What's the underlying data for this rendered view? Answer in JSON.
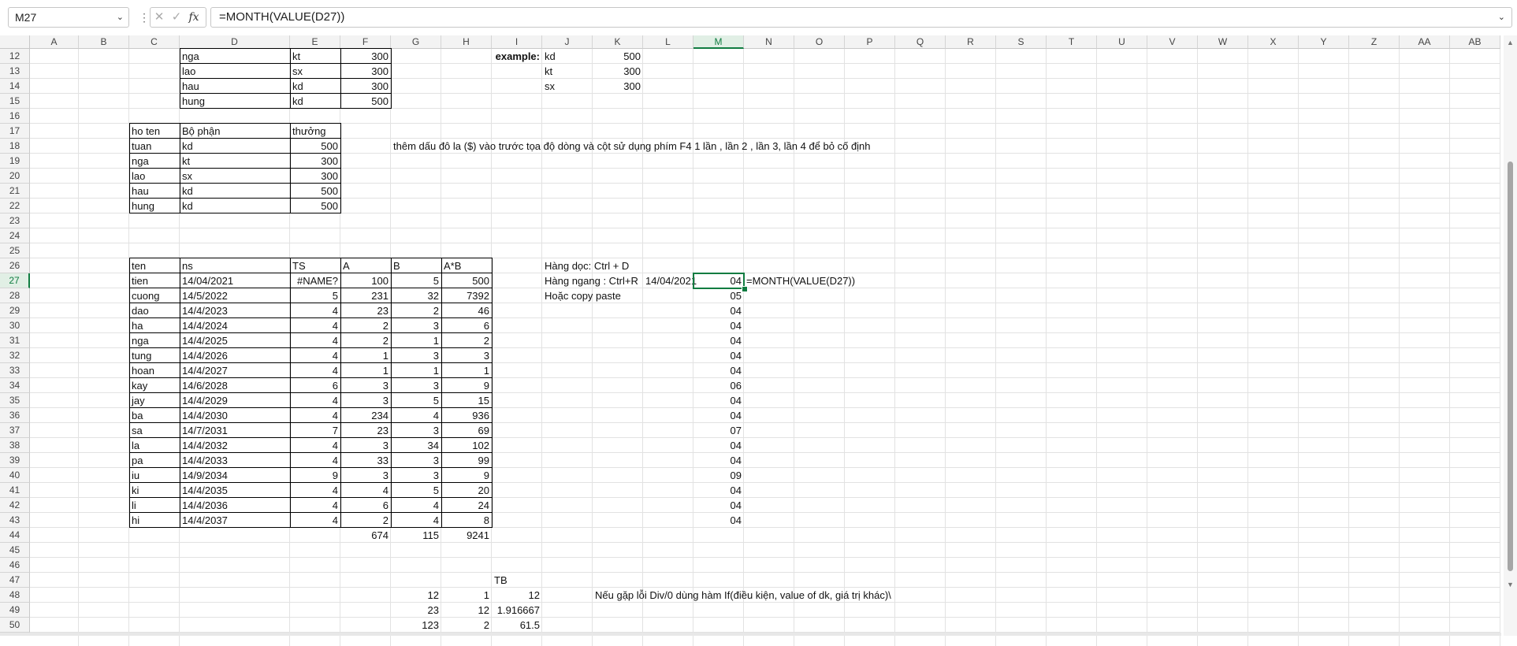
{
  "name_box": "M27",
  "formula": "=MONTH(VALUE(D27))",
  "selected_cell": "M27",
  "columns": [
    "A",
    "B",
    "C",
    "D",
    "E",
    "F",
    "G",
    "H",
    "I",
    "J",
    "K",
    "L",
    "M",
    "N",
    "O",
    "P",
    "Q",
    "R",
    "S",
    "T",
    "U",
    "V",
    "W",
    "X",
    "Y",
    "Z",
    "AA",
    "AB"
  ],
  "rows": [
    12,
    13,
    14,
    15,
    16,
    17,
    18,
    19,
    20,
    21,
    22,
    23,
    24,
    25,
    26,
    27,
    28,
    29,
    30,
    31,
    32,
    33,
    34,
    35,
    36,
    37,
    38,
    39,
    40,
    41,
    42,
    43,
    44,
    45,
    46,
    47,
    48,
    49,
    50
  ],
  "cells": [
    {
      "r": 12,
      "c": "D",
      "v": "nga"
    },
    {
      "r": 12,
      "c": "E",
      "v": "kt"
    },
    {
      "r": 12,
      "c": "F",
      "v": "300",
      "n": true
    },
    {
      "r": 13,
      "c": "D",
      "v": "lao"
    },
    {
      "r": 13,
      "c": "E",
      "v": "sx"
    },
    {
      "r": 13,
      "c": "F",
      "v": "300",
      "n": true
    },
    {
      "r": 14,
      "c": "D",
      "v": "hau"
    },
    {
      "r": 14,
      "c": "E",
      "v": "kd"
    },
    {
      "r": 14,
      "c": "F",
      "v": "300",
      "n": true
    },
    {
      "r": 15,
      "c": "D",
      "v": "hung"
    },
    {
      "r": 15,
      "c": "E",
      "v": "kd"
    },
    {
      "r": 15,
      "c": "F",
      "v": "500",
      "n": true
    },
    {
      "r": 12,
      "c": "I",
      "v": "example:",
      "b": true,
      "n": true
    },
    {
      "r": 12,
      "c": "J",
      "v": "kd"
    },
    {
      "r": 12,
      "c": "K",
      "v": "500",
      "n": true
    },
    {
      "r": 13,
      "c": "J",
      "v": "kt"
    },
    {
      "r": 13,
      "c": "K",
      "v": "300",
      "n": true
    },
    {
      "r": 14,
      "c": "J",
      "v": "sx"
    },
    {
      "r": 14,
      "c": "K",
      "v": "300",
      "n": true
    },
    {
      "r": 17,
      "c": "C",
      "v": "ho ten"
    },
    {
      "r": 17,
      "c": "D",
      "v": "Bộ phận"
    },
    {
      "r": 17,
      "c": "E",
      "v": "thưởng"
    },
    {
      "r": 18,
      "c": "C",
      "v": "tuan"
    },
    {
      "r": 18,
      "c": "D",
      "v": "kd"
    },
    {
      "r": 18,
      "c": "E",
      "v": "500",
      "n": true
    },
    {
      "r": 19,
      "c": "C",
      "v": "nga"
    },
    {
      "r": 19,
      "c": "D",
      "v": "kt"
    },
    {
      "r": 19,
      "c": "E",
      "v": "300",
      "n": true
    },
    {
      "r": 20,
      "c": "C",
      "v": "lao"
    },
    {
      "r": 20,
      "c": "D",
      "v": "sx"
    },
    {
      "r": 20,
      "c": "E",
      "v": "300",
      "n": true
    },
    {
      "r": 21,
      "c": "C",
      "v": "hau"
    },
    {
      "r": 21,
      "c": "D",
      "v": "kd"
    },
    {
      "r": 21,
      "c": "E",
      "v": "500",
      "n": true
    },
    {
      "r": 22,
      "c": "C",
      "v": "hung"
    },
    {
      "r": 22,
      "c": "D",
      "v": "kd"
    },
    {
      "r": 22,
      "c": "E",
      "v": "500",
      "n": true
    },
    {
      "r": 18,
      "c": "G",
      "v": "thêm dấu đô la ($) vào trước tọa độ dòng và cột sử dụng phím F4 1 lần , lần 2 , lần 3, lần 4 để bỏ cố định"
    },
    {
      "r": 26,
      "c": "C",
      "v": "ten"
    },
    {
      "r": 26,
      "c": "D",
      "v": "ns"
    },
    {
      "r": 26,
      "c": "E",
      "v": "TS"
    },
    {
      "r": 26,
      "c": "F",
      "v": "A"
    },
    {
      "r": 26,
      "c": "G",
      "v": "B"
    },
    {
      "r": 26,
      "c": "H",
      "v": "A*B"
    },
    {
      "r": 27,
      "c": "C",
      "v": "tien"
    },
    {
      "r": 27,
      "c": "D",
      "v": "14/04/2021"
    },
    {
      "r": 27,
      "c": "E",
      "v": "#NAME?",
      "n": true
    },
    {
      "r": 27,
      "c": "F",
      "v": "100",
      "n": true
    },
    {
      "r": 27,
      "c": "G",
      "v": "5",
      "n": true
    },
    {
      "r": 27,
      "c": "H",
      "v": "500",
      "n": true
    },
    {
      "r": 28,
      "c": "C",
      "v": "cuong"
    },
    {
      "r": 28,
      "c": "D",
      "v": "14/5/2022"
    },
    {
      "r": 28,
      "c": "E",
      "v": "5",
      "n": true
    },
    {
      "r": 28,
      "c": "F",
      "v": "231",
      "n": true
    },
    {
      "r": 28,
      "c": "G",
      "v": "32",
      "n": true
    },
    {
      "r": 28,
      "c": "H",
      "v": "7392",
      "n": true
    },
    {
      "r": 29,
      "c": "C",
      "v": "dao"
    },
    {
      "r": 29,
      "c": "D",
      "v": "14/4/2023"
    },
    {
      "r": 29,
      "c": "E",
      "v": "4",
      "n": true
    },
    {
      "r": 29,
      "c": "F",
      "v": "23",
      "n": true
    },
    {
      "r": 29,
      "c": "G",
      "v": "2",
      "n": true
    },
    {
      "r": 29,
      "c": "H",
      "v": "46",
      "n": true
    },
    {
      "r": 30,
      "c": "C",
      "v": "ha"
    },
    {
      "r": 30,
      "c": "D",
      "v": "14/4/2024"
    },
    {
      "r": 30,
      "c": "E",
      "v": "4",
      "n": true
    },
    {
      "r": 30,
      "c": "F",
      "v": "2",
      "n": true
    },
    {
      "r": 30,
      "c": "G",
      "v": "3",
      "n": true
    },
    {
      "r": 30,
      "c": "H",
      "v": "6",
      "n": true
    },
    {
      "r": 31,
      "c": "C",
      "v": "nga"
    },
    {
      "r": 31,
      "c": "D",
      "v": "14/4/2025"
    },
    {
      "r": 31,
      "c": "E",
      "v": "4",
      "n": true
    },
    {
      "r": 31,
      "c": "F",
      "v": "2",
      "n": true
    },
    {
      "r": 31,
      "c": "G",
      "v": "1",
      "n": true
    },
    {
      "r": 31,
      "c": "H",
      "v": "2",
      "n": true
    },
    {
      "r": 32,
      "c": "C",
      "v": "tung"
    },
    {
      "r": 32,
      "c": "D",
      "v": "14/4/2026"
    },
    {
      "r": 32,
      "c": "E",
      "v": "4",
      "n": true
    },
    {
      "r": 32,
      "c": "F",
      "v": "1",
      "n": true
    },
    {
      "r": 32,
      "c": "G",
      "v": "3",
      "n": true
    },
    {
      "r": 32,
      "c": "H",
      "v": "3",
      "n": true
    },
    {
      "r": 33,
      "c": "C",
      "v": "hoan"
    },
    {
      "r": 33,
      "c": "D",
      "v": "14/4/2027"
    },
    {
      "r": 33,
      "c": "E",
      "v": "4",
      "n": true
    },
    {
      "r": 33,
      "c": "F",
      "v": "1",
      "n": true
    },
    {
      "r": 33,
      "c": "G",
      "v": "1",
      "n": true
    },
    {
      "r": 33,
      "c": "H",
      "v": "1",
      "n": true
    },
    {
      "r": 34,
      "c": "C",
      "v": "kay"
    },
    {
      "r": 34,
      "c": "D",
      "v": "14/6/2028"
    },
    {
      "r": 34,
      "c": "E",
      "v": "6",
      "n": true
    },
    {
      "r": 34,
      "c": "F",
      "v": "3",
      "n": true
    },
    {
      "r": 34,
      "c": "G",
      "v": "3",
      "n": true
    },
    {
      "r": 34,
      "c": "H",
      "v": "9",
      "n": true
    },
    {
      "r": 35,
      "c": "C",
      "v": "jay"
    },
    {
      "r": 35,
      "c": "D",
      "v": "14/4/2029"
    },
    {
      "r": 35,
      "c": "E",
      "v": "4",
      "n": true
    },
    {
      "r": 35,
      "c": "F",
      "v": "3",
      "n": true
    },
    {
      "r": 35,
      "c": "G",
      "v": "5",
      "n": true
    },
    {
      "r": 35,
      "c": "H",
      "v": "15",
      "n": true
    },
    {
      "r": 36,
      "c": "C",
      "v": "ba"
    },
    {
      "r": 36,
      "c": "D",
      "v": "14/4/2030"
    },
    {
      "r": 36,
      "c": "E",
      "v": "4",
      "n": true
    },
    {
      "r": 36,
      "c": "F",
      "v": "234",
      "n": true
    },
    {
      "r": 36,
      "c": "G",
      "v": "4",
      "n": true
    },
    {
      "r": 36,
      "c": "H",
      "v": "936",
      "n": true
    },
    {
      "r": 37,
      "c": "C",
      "v": "sa"
    },
    {
      "r": 37,
      "c": "D",
      "v": "14/7/2031"
    },
    {
      "r": 37,
      "c": "E",
      "v": "7",
      "n": true
    },
    {
      "r": 37,
      "c": "F",
      "v": "23",
      "n": true
    },
    {
      "r": 37,
      "c": "G",
      "v": "3",
      "n": true
    },
    {
      "r": 37,
      "c": "H",
      "v": "69",
      "n": true
    },
    {
      "r": 38,
      "c": "C",
      "v": "la"
    },
    {
      "r": 38,
      "c": "D",
      "v": "14/4/2032"
    },
    {
      "r": 38,
      "c": "E",
      "v": "4",
      "n": true
    },
    {
      "r": 38,
      "c": "F",
      "v": "3",
      "n": true
    },
    {
      "r": 38,
      "c": "G",
      "v": "34",
      "n": true
    },
    {
      "r": 38,
      "c": "H",
      "v": "102",
      "n": true
    },
    {
      "r": 39,
      "c": "C",
      "v": "pa"
    },
    {
      "r": 39,
      "c": "D",
      "v": "14/4/2033"
    },
    {
      "r": 39,
      "c": "E",
      "v": "4",
      "n": true
    },
    {
      "r": 39,
      "c": "F",
      "v": "33",
      "n": true
    },
    {
      "r": 39,
      "c": "G",
      "v": "3",
      "n": true
    },
    {
      "r": 39,
      "c": "H",
      "v": "99",
      "n": true
    },
    {
      "r": 40,
      "c": "C",
      "v": "iu"
    },
    {
      "r": 40,
      "c": "D",
      "v": "14/9/2034"
    },
    {
      "r": 40,
      "c": "E",
      "v": "9",
      "n": true
    },
    {
      "r": 40,
      "c": "F",
      "v": "3",
      "n": true
    },
    {
      "r": 40,
      "c": "G",
      "v": "3",
      "n": true
    },
    {
      "r": 40,
      "c": "H",
      "v": "9",
      "n": true
    },
    {
      "r": 41,
      "c": "C",
      "v": "ki"
    },
    {
      "r": 41,
      "c": "D",
      "v": "14/4/2035"
    },
    {
      "r": 41,
      "c": "E",
      "v": "4",
      "n": true
    },
    {
      "r": 41,
      "c": "F",
      "v": "4",
      "n": true
    },
    {
      "r": 41,
      "c": "G",
      "v": "5",
      "n": true
    },
    {
      "r": 41,
      "c": "H",
      "v": "20",
      "n": true
    },
    {
      "r": 42,
      "c": "C",
      "v": "li"
    },
    {
      "r": 42,
      "c": "D",
      "v": "14/4/2036"
    },
    {
      "r": 42,
      "c": "E",
      "v": "4",
      "n": true
    },
    {
      "r": 42,
      "c": "F",
      "v": "6",
      "n": true
    },
    {
      "r": 42,
      "c": "G",
      "v": "4",
      "n": true
    },
    {
      "r": 42,
      "c": "H",
      "v": "24",
      "n": true
    },
    {
      "r": 43,
      "c": "C",
      "v": "hi"
    },
    {
      "r": 43,
      "c": "D",
      "v": "14/4/2037"
    },
    {
      "r": 43,
      "c": "E",
      "v": "4",
      "n": true
    },
    {
      "r": 43,
      "c": "F",
      "v": "2",
      "n": true
    },
    {
      "r": 43,
      "c": "G",
      "v": "4",
      "n": true
    },
    {
      "r": 43,
      "c": "H",
      "v": "8",
      "n": true
    },
    {
      "r": 44,
      "c": "F",
      "v": "674",
      "n": true
    },
    {
      "r": 44,
      "c": "G",
      "v": "115",
      "n": true
    },
    {
      "r": 44,
      "c": "H",
      "v": "9241",
      "n": true
    },
    {
      "r": 26,
      "c": "J",
      "v": "Hàng dọc: Ctrl + D"
    },
    {
      "r": 27,
      "c": "J",
      "v": "Hàng ngang : Ctrl+R"
    },
    {
      "r": 27,
      "c": "L",
      "v": "14/04/2021",
      "n": true
    },
    {
      "r": 27,
      "c": "M",
      "v": "04",
      "n": true
    },
    {
      "r": 27,
      "c": "N",
      "v": "=MONTH(VALUE(D27))"
    },
    {
      "r": 28,
      "c": "J",
      "v": "Hoặc copy paste"
    },
    {
      "r": 28,
      "c": "M",
      "v": "05",
      "n": true
    },
    {
      "r": 29,
      "c": "M",
      "v": "04",
      "n": true
    },
    {
      "r": 30,
      "c": "M",
      "v": "04",
      "n": true
    },
    {
      "r": 31,
      "c": "M",
      "v": "04",
      "n": true
    },
    {
      "r": 32,
      "c": "M",
      "v": "04",
      "n": true
    },
    {
      "r": 33,
      "c": "M",
      "v": "04",
      "n": true
    },
    {
      "r": 34,
      "c": "M",
      "v": "06",
      "n": true
    },
    {
      "r": 35,
      "c": "M",
      "v": "04",
      "n": true
    },
    {
      "r": 36,
      "c": "M",
      "v": "04",
      "n": true
    },
    {
      "r": 37,
      "c": "M",
      "v": "07",
      "n": true
    },
    {
      "r": 38,
      "c": "M",
      "v": "04",
      "n": true
    },
    {
      "r": 39,
      "c": "M",
      "v": "04",
      "n": true
    },
    {
      "r": 40,
      "c": "M",
      "v": "09",
      "n": true
    },
    {
      "r": 41,
      "c": "M",
      "v": "04",
      "n": true
    },
    {
      "r": 42,
      "c": "M",
      "v": "04",
      "n": true
    },
    {
      "r": 43,
      "c": "M",
      "v": "04",
      "n": true
    },
    {
      "r": 47,
      "c": "I",
      "v": "TB"
    },
    {
      "r": 48,
      "c": "G",
      "v": "12",
      "n": true
    },
    {
      "r": 48,
      "c": "H",
      "v": "1",
      "n": true
    },
    {
      "r": 48,
      "c": "I",
      "v": "12",
      "n": true
    },
    {
      "r": 48,
      "c": "K",
      "v": "Nếu gặp lỗi Div/0 dùng hàm If(điều kiện, value of dk, giá trị khác)\\"
    },
    {
      "r": 49,
      "c": "G",
      "v": "23",
      "n": true
    },
    {
      "r": 49,
      "c": "H",
      "v": "12",
      "n": true
    },
    {
      "r": 49,
      "c": "I",
      "v": "1.916667",
      "n": true
    },
    {
      "r": 50,
      "c": "G",
      "v": "123",
      "n": true
    },
    {
      "r": 50,
      "c": "H",
      "v": "2",
      "n": true
    },
    {
      "r": 50,
      "c": "I",
      "v": "61.5",
      "n": true
    }
  ]
}
